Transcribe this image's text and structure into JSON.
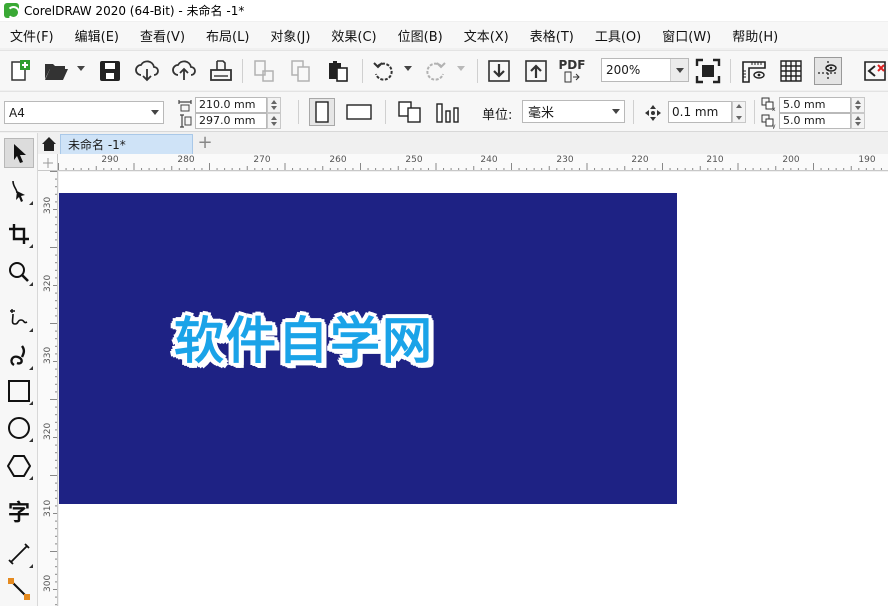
{
  "window": {
    "title": "CorelDRAW 2020 (64-Bit) - 未命名 -1*"
  },
  "menu": [
    "文件(F)",
    "编辑(E)",
    "查看(V)",
    "布局(L)",
    "对象(J)",
    "效果(C)",
    "位图(B)",
    "文本(X)",
    "表格(T)",
    "工具(O)",
    "窗口(W)",
    "帮助(H)"
  ],
  "toolbar": {
    "zoom": "200%",
    "pdf_label": "PDF",
    "icons": [
      "new-document-icon",
      "open-folder-icon",
      "save-icon",
      "cloud-download-icon",
      "cloud-upload-icon",
      "print-icon",
      "cut-icon",
      "copy-icon",
      "paste-icon",
      "undo-icon",
      "redo-icon",
      "import-icon",
      "export-icon",
      "publish-pdf-icon",
      "full-screen-icon",
      "show-rulers-icon",
      "show-grid-icon",
      "show-guidelines-icon",
      "snap-to-icon"
    ]
  },
  "property_bar": {
    "page_size": "A4",
    "width": "210.0 mm",
    "height": "297.0 mm",
    "units_label": "单位:",
    "units_value": "毫米",
    "nudge": "0.1 mm",
    "duplicate_x": "5.0 mm",
    "duplicate_y": "5.0 mm"
  },
  "tabs": {
    "document": "未命名 -1*"
  },
  "ruler": {
    "horizontal": [
      "290",
      "280",
      "270",
      "260",
      "250",
      "240",
      "230",
      "220",
      "210",
      "200",
      "190"
    ],
    "vertical": [
      "330",
      "320",
      "310",
      "300"
    ]
  },
  "canvas": {
    "artwork_text": "软件自学网",
    "rect_color": "#1e2284",
    "text_color": "#1aa3e8",
    "outline_color": "#ffffff"
  },
  "toolbox": [
    "pick-tool-icon",
    "shape-tool-icon",
    "crop-tool-icon",
    "zoom-tool-icon",
    "freehand-tool-icon",
    "artistic-media-tool-icon",
    "rectangle-tool-icon",
    "ellipse-tool-icon",
    "polygon-tool-icon",
    "text-tool-icon",
    "parallel-dimension-tool-icon",
    "connector-tool-icon"
  ],
  "toolbox_text_glyph": "字"
}
